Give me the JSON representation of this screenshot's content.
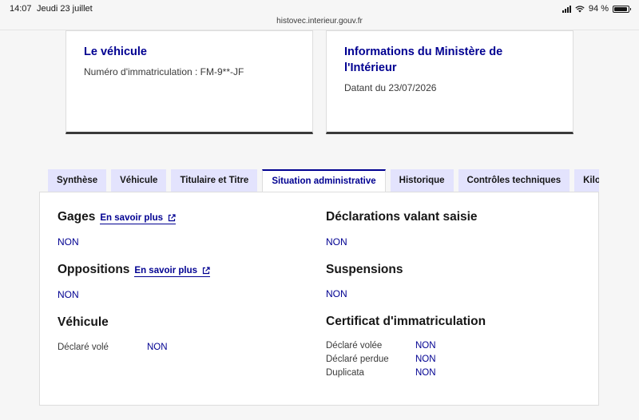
{
  "status": {
    "time": "14:07",
    "date": "Jeudi 23 juillet",
    "battery": "94 %",
    "battery_level": 0.94
  },
  "browser": {
    "url": "histovec.interieur.gouv.fr"
  },
  "cards": [
    {
      "title": "Le véhicule",
      "subtitle": "Numéro d'immatriculation : FM-9**-JF"
    },
    {
      "title": "Informations du Ministère de l'Intérieur",
      "subtitle": "Datant du 23/07/2026"
    }
  ],
  "tabs": [
    {
      "label": "Synthèse"
    },
    {
      "label": "Véhicule"
    },
    {
      "label": "Titulaire et Titre"
    },
    {
      "label": "Situation administrative"
    },
    {
      "label": "Historique"
    },
    {
      "label": "Contrôles techniques"
    },
    {
      "label": "Kilo"
    }
  ],
  "panel": {
    "gages": {
      "title": "Gages",
      "link": "En savoir plus",
      "value": "NON"
    },
    "oppositions": {
      "title": "Oppositions",
      "link": "En savoir plus",
      "value": "NON"
    },
    "vehicule": {
      "title": "Véhicule",
      "rows": [
        {
          "label": "Déclaré volé",
          "value": "NON"
        }
      ]
    },
    "saisie": {
      "title": "Déclarations valant saisie",
      "value": "NON"
    },
    "suspensions": {
      "title": "Suspensions",
      "value": "NON"
    },
    "certificat": {
      "title": "Certificat d'immatriculation",
      "rows": [
        {
          "label": "Déclaré volée",
          "value": "NON"
        },
        {
          "label": "Déclaré perdue",
          "value": "NON"
        },
        {
          "label": "Duplicata",
          "value": "NON"
        }
      ]
    }
  }
}
